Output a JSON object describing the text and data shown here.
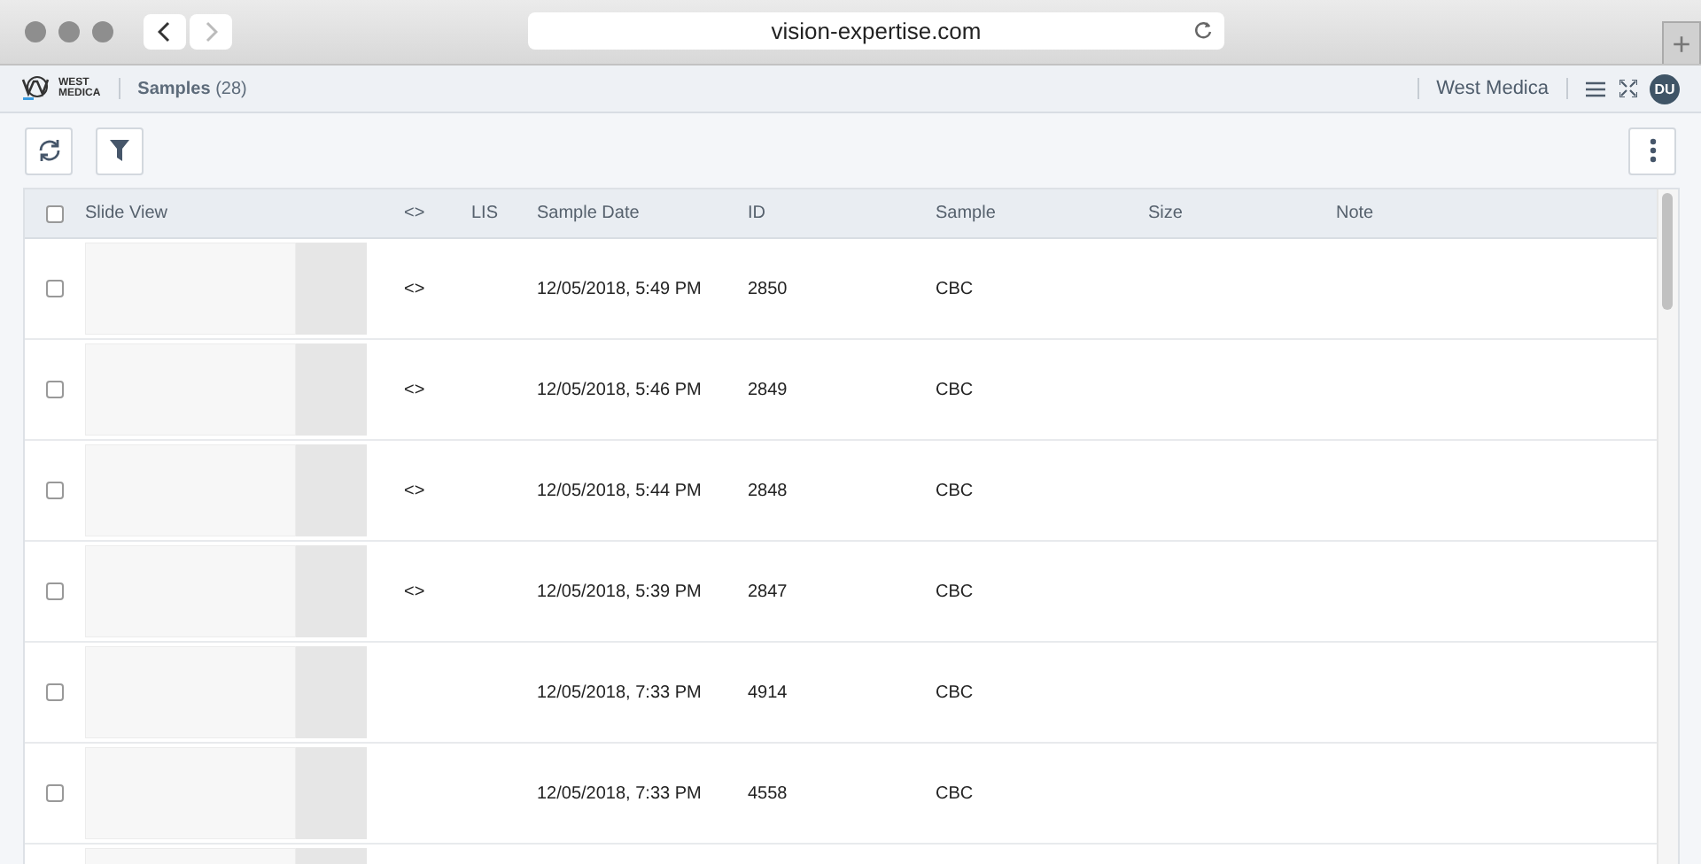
{
  "browser": {
    "url": "vision-expertise.com",
    "new_tab": "+"
  },
  "header": {
    "logo_top": "WEST",
    "logo_bottom": "MEDICA",
    "page_title": "Samples",
    "count": "(28)",
    "org": "West Medica",
    "avatar": "DU"
  },
  "table": {
    "all_checked": false,
    "columns": [
      "Slide View",
      "<>",
      "LIS",
      "Sample Date",
      "ID",
      "Sample",
      "Size",
      "Note"
    ],
    "rows": [
      {
        "checked": false,
        "code": "<>",
        "date": "12/05/2018, 5:49 PM",
        "id": "2850",
        "sample": "CBC"
      },
      {
        "checked": false,
        "code": "<>",
        "date": "12/05/2018, 5:46 PM",
        "id": "2849",
        "sample": "CBC"
      },
      {
        "checked": false,
        "code": "<>",
        "date": "12/05/2018, 5:44 PM",
        "id": "2848",
        "sample": "CBC"
      },
      {
        "checked": false,
        "code": "<>",
        "date": "12/05/2018, 5:39 PM",
        "id": "2847",
        "sample": "CBC"
      },
      {
        "checked": false,
        "date": "12/05/2018, 7:33 PM",
        "id": "4914",
        "sample": "CBC"
      },
      {
        "checked": false,
        "date": "12/05/2018, 7:33 PM",
        "id": "4558",
        "sample": "CBC"
      }
    ]
  }
}
